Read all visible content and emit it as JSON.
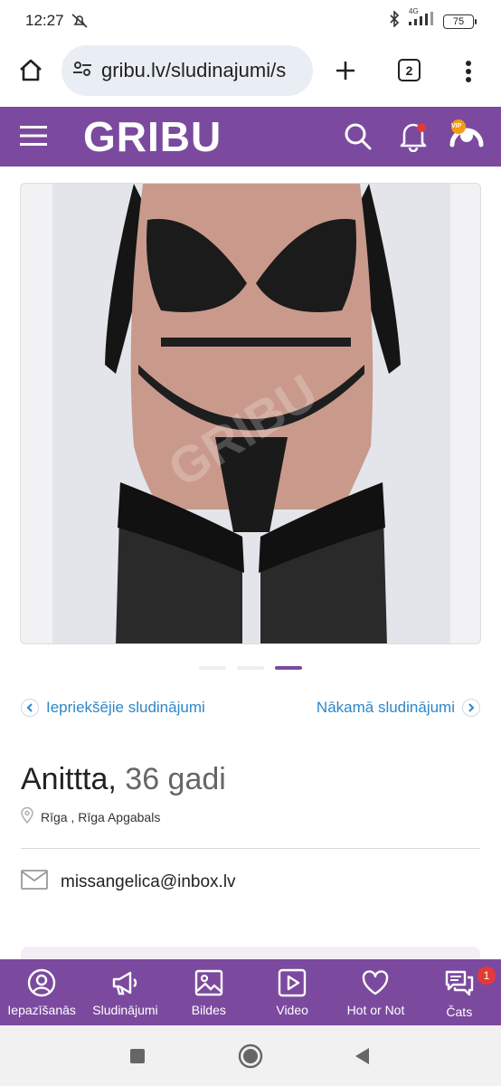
{
  "status_bar": {
    "time": "12:27",
    "battery": "75",
    "network": "4G"
  },
  "browser": {
    "url": "gribu.lv/sludinajumi/s",
    "tab_count": "2"
  },
  "header": {
    "logo": "GRIBU",
    "vip_label": "VIP"
  },
  "gallery": {
    "slide_count": 3,
    "active_slide": 3,
    "watermark": "GRIBU"
  },
  "listing_nav": {
    "prev_label": "Iepriekšējie sludinājumi",
    "next_label": "Nākamā sludinājumi"
  },
  "profile": {
    "name": "Anittta,",
    "age": "36 gadi",
    "city": "Rīga",
    "separator": " , ",
    "region": "Rīga Apgabals",
    "email": "missangelica@inbox.lv"
  },
  "bottom_nav": {
    "items": [
      {
        "label": "Iepazīšanās",
        "icon": "profile-icon"
      },
      {
        "label": "Sludinājumi",
        "icon": "megaphone-icon"
      },
      {
        "label": "Bildes",
        "icon": "image-icon"
      },
      {
        "label": "Video",
        "icon": "play-icon"
      },
      {
        "label": "Hot or Not",
        "icon": "heart-icon"
      },
      {
        "label": "Čats",
        "icon": "chat-icon",
        "badge": "1"
      }
    ]
  },
  "colors": {
    "brand_purple": "#7b4a9e",
    "link_blue": "#2d86c8",
    "badge_red": "#e53935"
  }
}
